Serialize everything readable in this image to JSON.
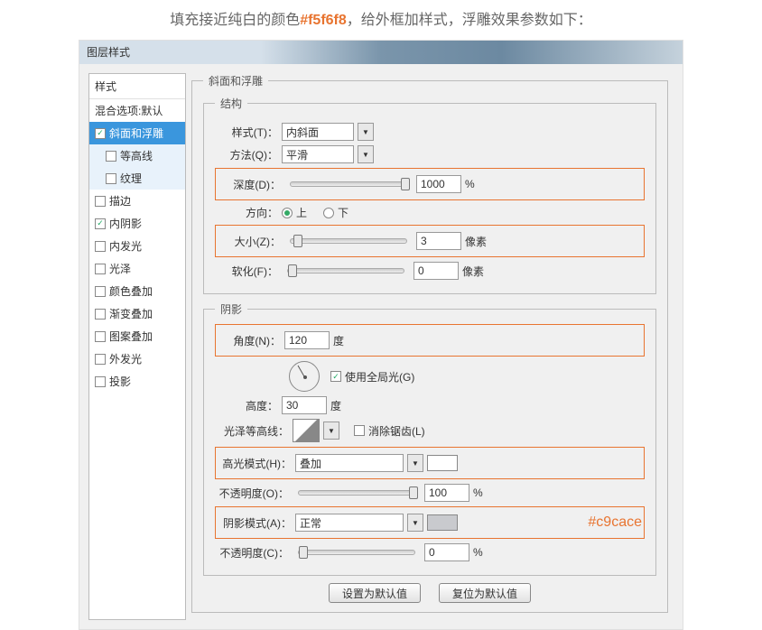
{
  "header": {
    "prefix": "填充接近纯白的颜色",
    "hex": "#f5f6f8",
    "suffix": "，给外框加样式，浮雕效果参数如下："
  },
  "dialog": {
    "title": "图层样式"
  },
  "sidebar": {
    "header": "样式",
    "blend": "混合选项:默认",
    "items": [
      {
        "label": "斜面和浮雕",
        "checked": true,
        "sel": true
      },
      {
        "label": "等高线",
        "checked": false,
        "indent": true
      },
      {
        "label": "纹理",
        "checked": false,
        "indent": true
      },
      {
        "label": "描边",
        "checked": false
      },
      {
        "label": "内阴影",
        "checked": true
      },
      {
        "label": "内发光",
        "checked": false
      },
      {
        "label": "光泽",
        "checked": false
      },
      {
        "label": "颜色叠加",
        "checked": false
      },
      {
        "label": "渐变叠加",
        "checked": false
      },
      {
        "label": "图案叠加",
        "checked": false
      },
      {
        "label": "外发光",
        "checked": false
      },
      {
        "label": "投影",
        "checked": false
      }
    ]
  },
  "panel_title": "斜面和浮雕",
  "struct": {
    "legend": "结构",
    "style_l": "样式(T)：",
    "style_v": "内斜面",
    "method_l": "方法(Q)：",
    "method_v": "平滑",
    "depth_l": "深度(D)：",
    "depth_v": "1000",
    "depth_u": "%",
    "dir_l": "方向：",
    "up": "上",
    "down": "下",
    "size_l": "大小(Z)：",
    "size_v": "3",
    "size_u": "像素",
    "soft_l": "软化(F)：",
    "soft_v": "0",
    "soft_u": "像素"
  },
  "shadow": {
    "legend": "阴影",
    "angle_l": "角度(N)：",
    "angle_v": "120",
    "angle_u": "度",
    "global": "使用全局光(G)",
    "alt_l": "高度：",
    "alt_v": "30",
    "alt_u": "度",
    "gloss_l": "光泽等高线：",
    "anti": "消除锯齿(L)",
    "hi_mode_l": "高光模式(H)：",
    "hi_mode_v": "叠加",
    "hi_op_l": "不透明度(O)：",
    "hi_op_v": "100",
    "pct": "%",
    "sh_mode_l": "阴影模式(A)：",
    "sh_mode_v": "正常",
    "sh_hex": "#c9cace",
    "sh_op_l": "不透明度(C)：",
    "sh_op_v": "0"
  },
  "buttons": {
    "default": "设置为默认值",
    "reset": "复位为默认值"
  }
}
